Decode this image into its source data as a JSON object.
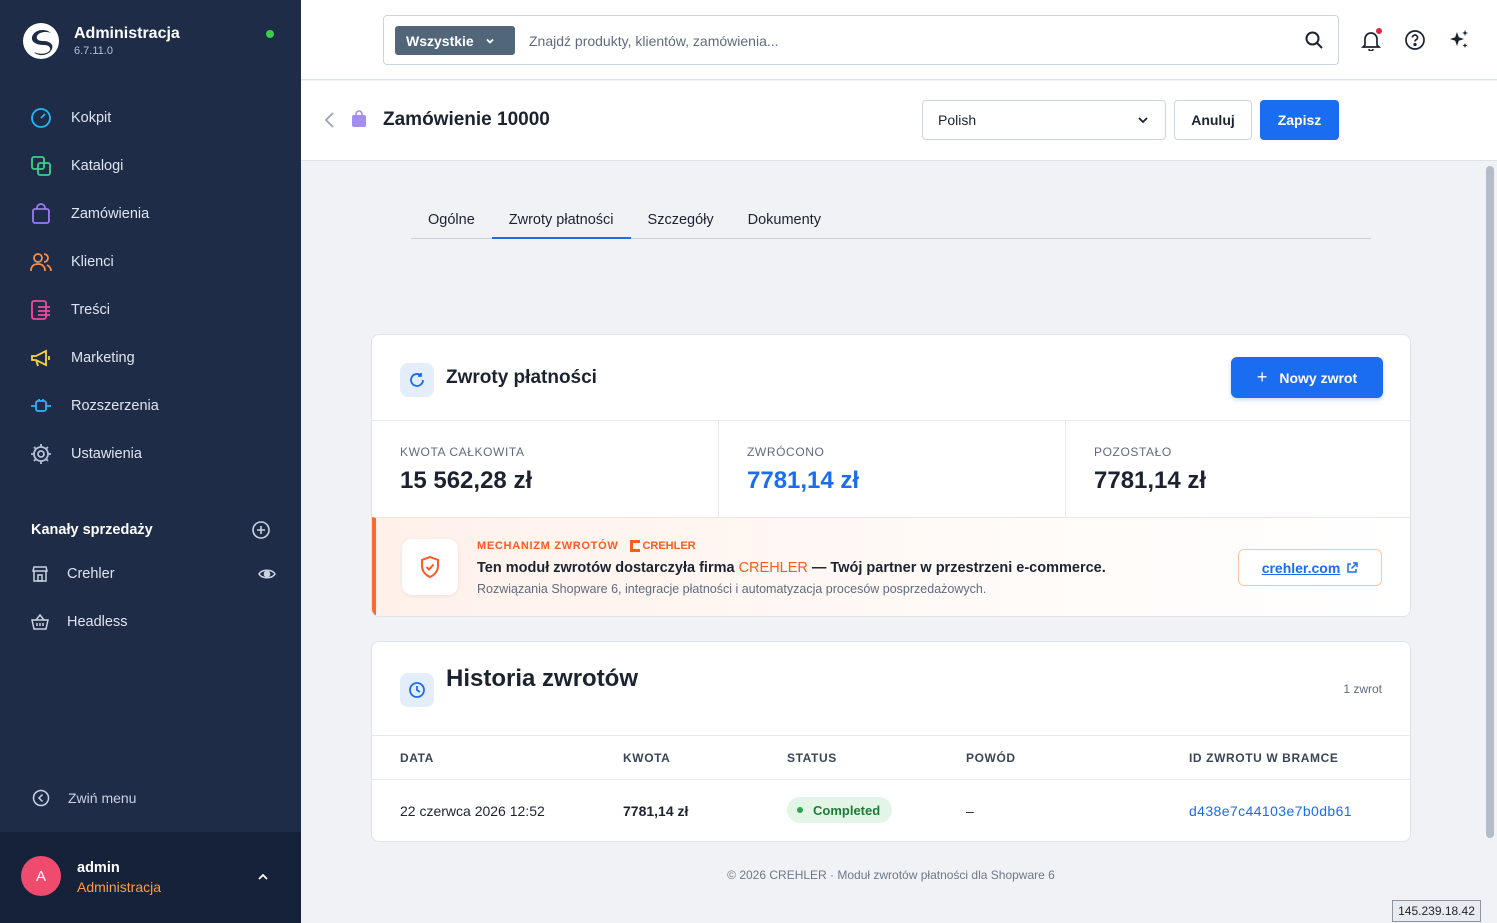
{
  "sidebar": {
    "app_title": "Administracja",
    "version": "6.7.11.0",
    "nav": [
      {
        "label": "Kokpit",
        "icon": "dashboard-icon",
        "color": "#29b6f6"
      },
      {
        "label": "Katalogi",
        "icon": "catalog-icon",
        "color": "#3bd18c"
      },
      {
        "label": "Zamówienia",
        "icon": "orders-icon",
        "color": "#9a7cf4"
      },
      {
        "label": "Klienci",
        "icon": "customers-icon",
        "color": "#ff8c42"
      },
      {
        "label": "Treści",
        "icon": "content-icon",
        "color": "#ee4b9b"
      },
      {
        "label": "Marketing",
        "icon": "marketing-icon",
        "color": "#ffd43b"
      },
      {
        "label": "Rozszerzenia",
        "icon": "extensions-icon",
        "color": "#29b6f6"
      },
      {
        "label": "Ustawienia",
        "icon": "settings-icon",
        "color": "#b6c1d3"
      }
    ],
    "channels_title": "Kanały sprzedaży",
    "channels": [
      {
        "label": "Crehler",
        "icon": "storefront-icon"
      },
      {
        "label": "Headless",
        "icon": "basket-icon"
      }
    ],
    "collapse_label": "Zwiń menu",
    "user": {
      "initial": "A",
      "name": "admin",
      "role": "Administracja"
    }
  },
  "search": {
    "scope": "Wszystkie",
    "placeholder": "Znajdź produkty, klientów, zamówienia..."
  },
  "smartbar": {
    "title": "Zamówienie 10000",
    "language": "Polish",
    "cancel_label": "Anuluj",
    "save_label": "Zapisz"
  },
  "tabs": [
    "Ogólne",
    "Zwroty płatności",
    "Szczegóły",
    "Dokumenty"
  ],
  "refunds": {
    "title": "Zwroty płatności",
    "new_button": "Nowy zwrot",
    "new_button_plus": "+",
    "stats": [
      {
        "label": "KWOTA CAŁKOWITA",
        "value": "15 562,28 zł"
      },
      {
        "label": "ZWRÓCONO",
        "value": "7781,14 zł"
      },
      {
        "label": "POZOSTAŁO",
        "value": "7781,14 zł"
      }
    ]
  },
  "promo": {
    "tag": "MECHANIZM ZWROTÓW",
    "brand": "CREHLER",
    "main_before": "Ten moduł zwrotów dostarczyła firma",
    "main_brand": "CREHLER",
    "main_after": "— Twój partner w przestrzeni e-commerce.",
    "sub": "Rozwiązania Shopware 6, integracje płatności i automatyzacja procesów posprzedażowych.",
    "link": "crehler.com",
    "accent": "#ff5a1f"
  },
  "history": {
    "title": "Historia zwrotów",
    "count": "1 zwrot",
    "columns": [
      "DATA",
      "KWOTA",
      "STATUS",
      "POWÓD",
      "ID ZWROTU W BRAMCE"
    ],
    "rows": [
      {
        "date": "22 czerwca 2026 12:52",
        "amount": "7781,14 zł",
        "status": "Completed",
        "reason": "–",
        "gateway_id": "d438e7c44103e7b0db61"
      }
    ]
  },
  "footer": "© 2026 CREHLER · Moduł zwrotów płatności dla Shopware 6",
  "ip_label": "145.239.18.42",
  "colors": {
    "primary": "#1a6cf0",
    "sidebar": "#1e2c48",
    "success": "#2ea44f"
  }
}
